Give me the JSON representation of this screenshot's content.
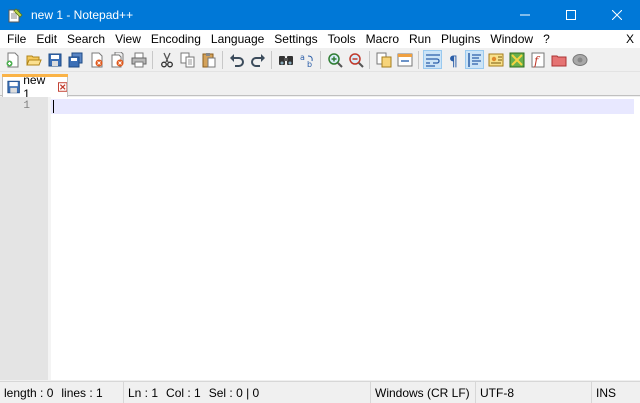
{
  "window": {
    "title": "new 1 - Notepad++",
    "accent_color": "#0078d7",
    "controls": [
      "minimize-icon",
      "maximize-icon",
      "close-icon"
    ]
  },
  "menu": {
    "items": [
      "File",
      "Edit",
      "Search",
      "View",
      "Encoding",
      "Language",
      "Settings",
      "Tools",
      "Macro",
      "Run",
      "Plugins",
      "Window",
      "?"
    ],
    "close": "X"
  },
  "toolbar": {
    "buttons": [
      "new-file-icon",
      "open-file-icon",
      "save-icon",
      "save-all-icon",
      "close-icon",
      "close-all-icon",
      "print-icon",
      "cut-icon",
      "copy-icon",
      "paste-icon",
      "undo-icon",
      "redo-icon",
      "find-icon",
      "replace-icon",
      "zoom-in-icon",
      "zoom-out-icon",
      "sync-vertical-icon",
      "sync-horizontal-icon",
      "word-wrap-icon",
      "show-all-characters-icon",
      "indent-guide-icon",
      "user-defined-language-icon",
      "document-map-icon",
      "function-list-icon",
      "folder-as-workspace-icon",
      "record-macro-icon"
    ]
  },
  "tabs": [
    {
      "label": "new 1",
      "active": true,
      "tab_accent": "#fab347"
    }
  ],
  "editor": {
    "line_numbers": [
      "1"
    ],
    "current_line_color": "#e8e8ff"
  },
  "status": {
    "length": "length : 0",
    "lines": "lines : 1",
    "ln": "Ln : 1",
    "col": "Col : 1",
    "sel": "Sel : 0 | 0",
    "eol": "Windows (CR LF)",
    "encoding": "UTF-8",
    "mode": "INS"
  }
}
